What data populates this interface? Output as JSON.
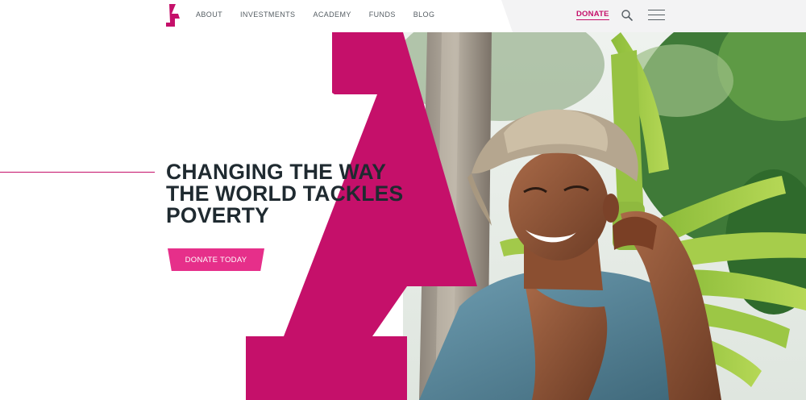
{
  "nav": {
    "items": [
      {
        "label": "ABOUT"
      },
      {
        "label": "INVESTMENTS"
      },
      {
        "label": "ACADEMY"
      },
      {
        "label": "FUNDS"
      },
      {
        "label": "BLOG"
      }
    ],
    "donate_label": "DONATE"
  },
  "hero": {
    "headline_lines": [
      "CHANGING THE WAY",
      "THE WORLD TACKLES",
      "POVERTY"
    ],
    "cta_label": "DONATE TODAY"
  },
  "icons": {
    "logo": "brand-logo-icon",
    "search": "search-icon",
    "menu": "hamburger-menu-icon"
  },
  "colors": {
    "brand_magenta": "#c5106a",
    "cta_pink": "#e62f8a",
    "headline_text": "#1f2a30",
    "nav_text": "#555d63"
  }
}
